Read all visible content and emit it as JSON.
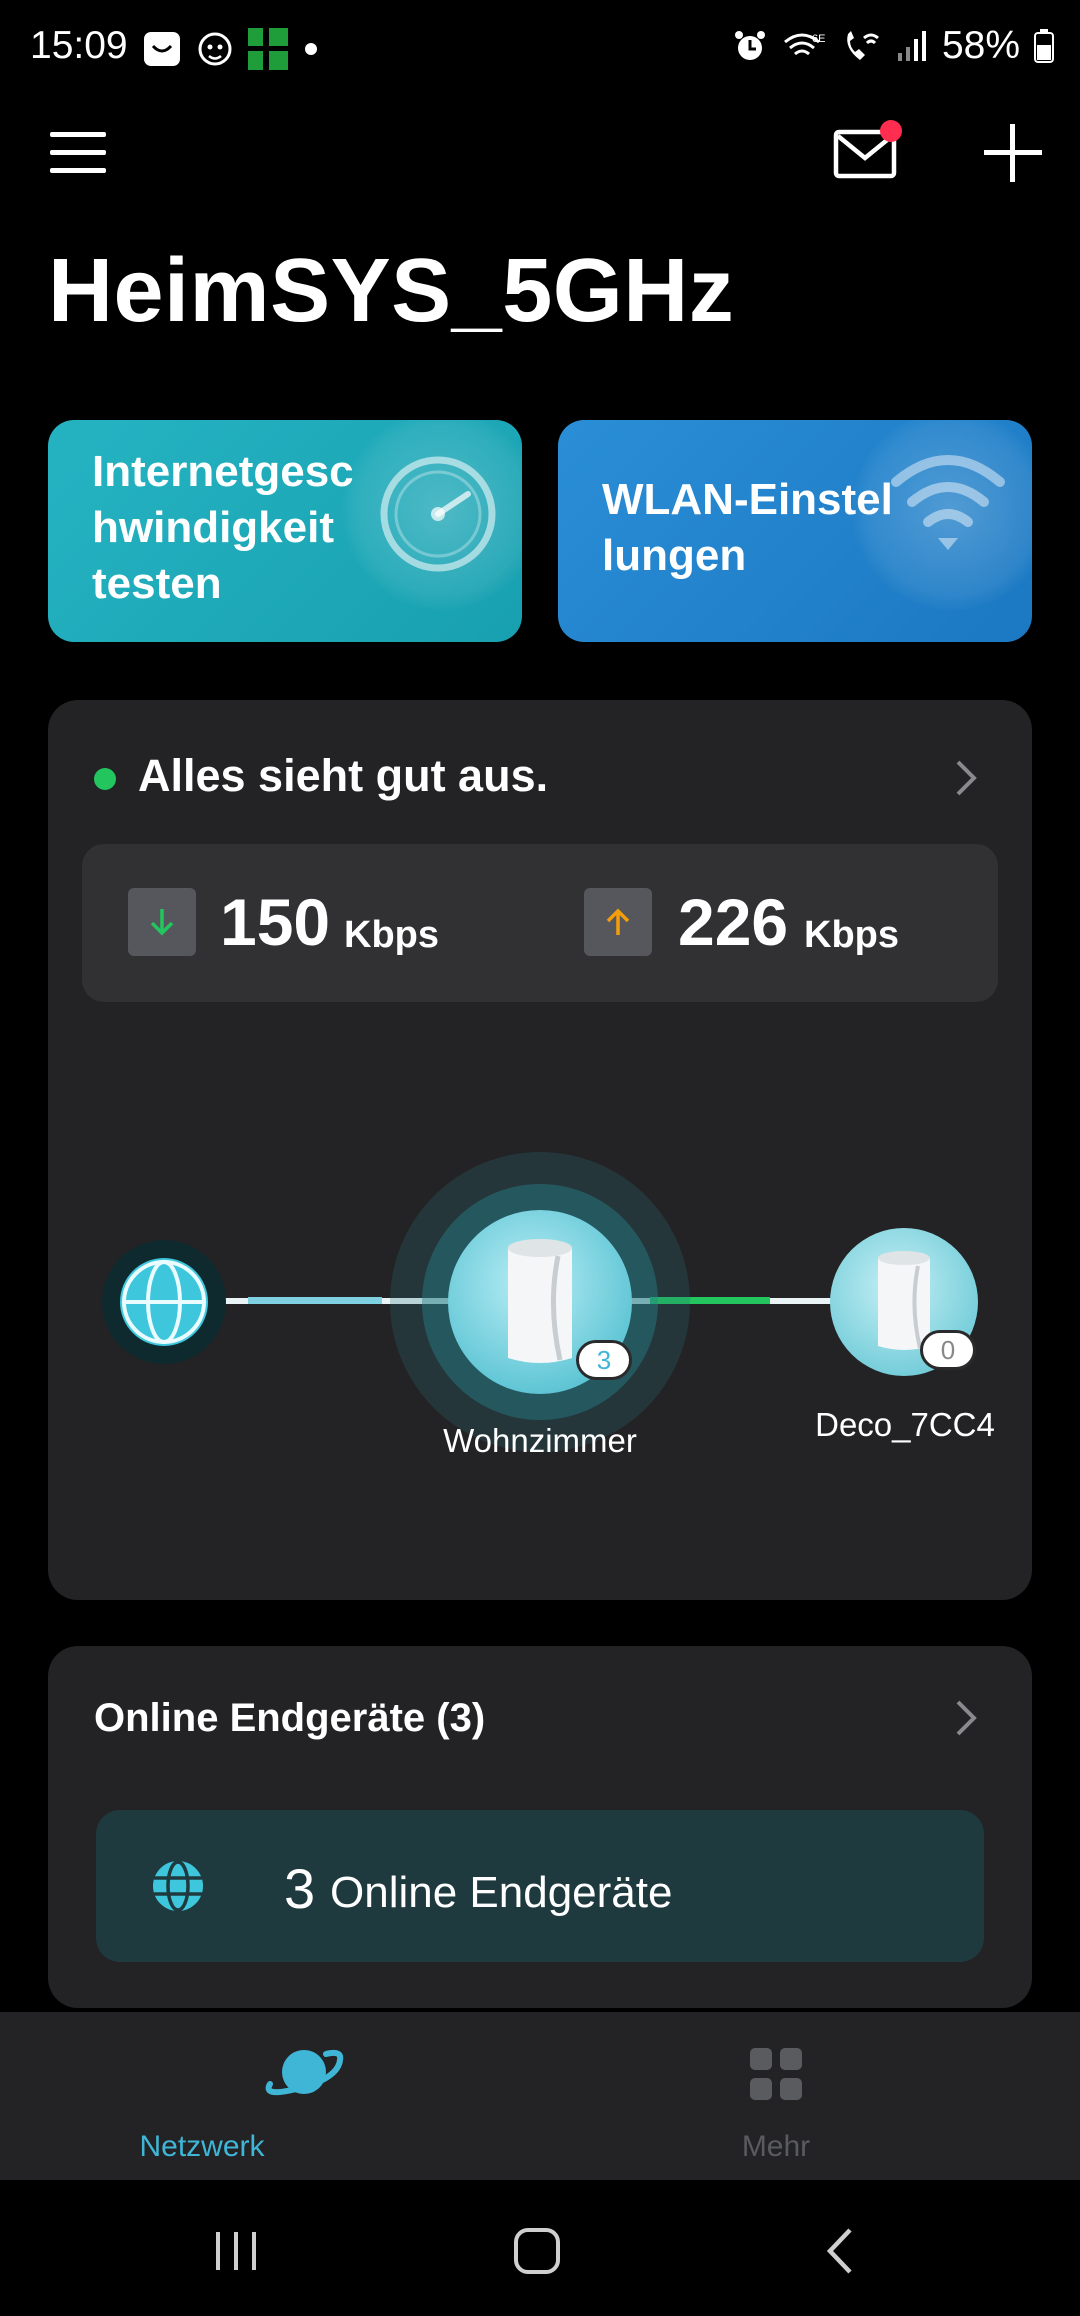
{
  "status_bar": {
    "time": "15:09",
    "battery": "58%",
    "icons": [
      "notification-bag-icon",
      "lion-app-icon",
      "green-app-icon",
      "dot-icon",
      "alarm-icon",
      "wifi-6e-icon",
      "wifi-call-icon",
      "signal-icon",
      "battery-icon"
    ]
  },
  "header": {
    "title": "HeimSYS_5GHz",
    "has_unread_mail": true
  },
  "tiles": {
    "speed_test": "Internetgesc\nhwindigkeit\ntesten",
    "wlan_settings": "WLAN-Einstel\nlungen"
  },
  "status": {
    "message": "Alles sieht gut aus.",
    "download_value": "150",
    "download_unit": "Kbps",
    "upload_value": "226",
    "upload_unit": "Kbps"
  },
  "topology": {
    "main_node_label": "Wohnzimmer",
    "main_node_clients": "3",
    "satellite_label": "Deco_7CC4",
    "satellite_clients": "0"
  },
  "devices": {
    "title": "Online Endgeräte (3)",
    "count": "3",
    "label": "Online Endgeräte"
  },
  "bottom_nav": {
    "network": "Netzwerk",
    "more": "Mehr"
  },
  "colors": {
    "accent": "#3fb6d6",
    "status_ok": "#22c55e",
    "download": "#22c55e",
    "upload": "#f59e0b",
    "notification": "#ff2d4f"
  }
}
